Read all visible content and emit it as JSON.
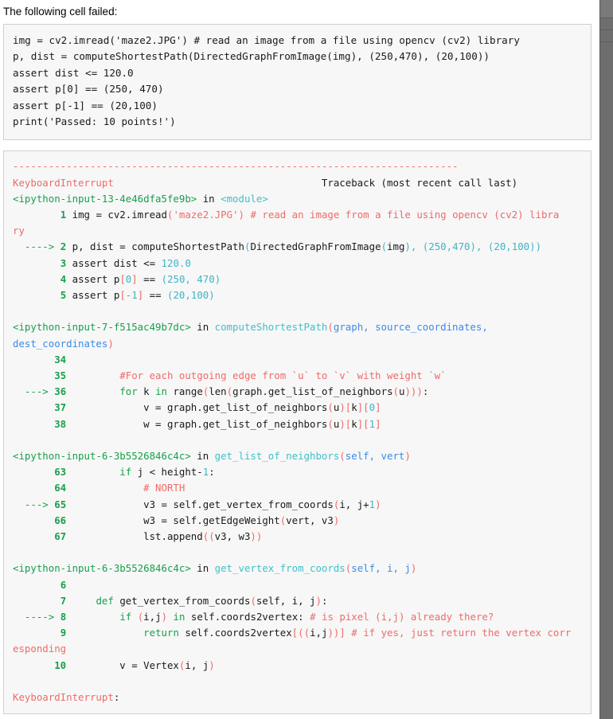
{
  "page": {
    "lead_text": "The following cell failed:",
    "background": "#ffffff",
    "cell_background": "#f7f7f7",
    "cell_border": "#cfcfcf"
  },
  "colors": {
    "string": "#ef6b68",
    "comment": "#ef6b68",
    "number": "#40b4c4",
    "keyword": "#18a04a",
    "function": "#3fc0c9",
    "argument": "#3b8ae8",
    "punctuation": "#ef6b68",
    "error": "#ef6b68",
    "line_number": "#18a04a",
    "scrollbar": "#6e6e6e"
  },
  "input_cell": {
    "lines": [
      [
        {
          "t": "img = cv2.imread(",
          "c": "plain"
        },
        {
          "t": "'maze2.JPG'",
          "c": "plain"
        },
        {
          "t": ") # read an image from a file using opencv (cv2) library",
          "c": "plain"
        }
      ],
      [
        {
          "t": "p, dist = computeShortestPath(DirectedGraphFromImage(img), (250,470), (20,100))",
          "c": "plain"
        }
      ],
      [
        {
          "t": "assert dist <= 120.0",
          "c": "plain"
        }
      ],
      [
        {
          "t": "assert p[0] == (250, 470)",
          "c": "plain"
        }
      ],
      [
        {
          "t": "assert p[-1] == (20,100)",
          "c": "plain"
        }
      ],
      [
        {
          "t": "print('Passed: 10 points!')",
          "c": "plain"
        }
      ]
    ]
  },
  "traceback": {
    "separator": "---------------------------------------------------------------------------",
    "exception_name": "KeyboardInterrupt",
    "exception_header_right": "Traceback (most recent call last)",
    "exception_footer": "KeyboardInterrupt:",
    "frames": [
      {
        "location": "<ipython-input-13-4e46dfa5fe9b>",
        "in_word": "in",
        "scope": "<module>",
        "scope_args": "",
        "lines": [
          {
            "arrow": "",
            "number": "1",
            "segments": [
              {
                "t": "img = cv2.imread",
                "c": "plain"
              },
              {
                "t": "(",
                "c": "punc"
              },
              {
                "t": "'maze2.JPG'",
                "c": "str"
              },
              {
                "t": ")",
                "c": "punc"
              },
              {
                "t": " # read an image from a file using opencv (cv2) libra",
                "c": "com"
              }
            ],
            "wrap": "ry",
            "wrap_class": "com"
          },
          {
            "arrow": "---->",
            "number": "2",
            "segments": [
              {
                "t": "p, dist = computeShortestPath",
                "c": "plain"
              },
              {
                "t": "(",
                "c": "num"
              },
              {
                "t": "DirectedGraphFromImage",
                "c": "plain"
              },
              {
                "t": "(",
                "c": "num"
              },
              {
                "t": "img",
                "c": "plain"
              },
              {
                "t": "), (",
                "c": "num"
              },
              {
                "t": "250",
                "c": "num"
              },
              {
                "t": ",",
                "c": "num"
              },
              {
                "t": "470",
                "c": "num"
              },
              {
                "t": "), (",
                "c": "num"
              },
              {
                "t": "20",
                "c": "num"
              },
              {
                "t": ",",
                "c": "num"
              },
              {
                "t": "100",
                "c": "num"
              },
              {
                "t": "))",
                "c": "num"
              }
            ],
            "wrap": "",
            "wrap_class": ""
          },
          {
            "arrow": "",
            "number": "3",
            "segments": [
              {
                "t": "assert dist <= ",
                "c": "plain"
              },
              {
                "t": "120.0",
                "c": "num"
              }
            ],
            "wrap": "",
            "wrap_class": ""
          },
          {
            "arrow": "",
            "number": "4",
            "segments": [
              {
                "t": "assert p",
                "c": "plain"
              },
              {
                "t": "[",
                "c": "punc"
              },
              {
                "t": "0",
                "c": "num"
              },
              {
                "t": "]",
                "c": "punc"
              },
              {
                "t": " == ",
                "c": "plain"
              },
              {
                "t": "(250, 470)",
                "c": "num"
              }
            ],
            "wrap": "",
            "wrap_class": ""
          },
          {
            "arrow": "",
            "number": "5",
            "segments": [
              {
                "t": "assert p",
                "c": "plain"
              },
              {
                "t": "[",
                "c": "punc"
              },
              {
                "t": "-1",
                "c": "num"
              },
              {
                "t": "]",
                "c": "punc"
              },
              {
                "t": " == ",
                "c": "plain"
              },
              {
                "t": "(20,100)",
                "c": "num"
              }
            ],
            "wrap": "",
            "wrap_class": ""
          }
        ]
      },
      {
        "location": "<ipython-input-7-f515ac49b7dc>",
        "in_word": "in",
        "scope": "computeShortestPath",
        "scope_args": "graph, source_coordinates, dest_coordinates",
        "scope_wrap": "dinates)",
        "scope_head": "computeShortestPath",
        "lines": [
          {
            "arrow": "",
            "number": "34",
            "segments": [],
            "wrap": "",
            "wrap_class": ""
          },
          {
            "arrow": "",
            "number": "35",
            "segments": [
              {
                "t": "        #For each outgoing edge from `u` to `v` with weight `w`",
                "c": "com"
              }
            ],
            "wrap": "",
            "wrap_class": ""
          },
          {
            "arrow": "--->",
            "number": "36",
            "segments": [
              {
                "t": "        ",
                "c": "plain"
              },
              {
                "t": "for",
                "c": "kw"
              },
              {
                "t": " k ",
                "c": "plain"
              },
              {
                "t": "in",
                "c": "kw"
              },
              {
                "t": " range",
                "c": "plain"
              },
              {
                "t": "(",
                "c": "punc"
              },
              {
                "t": "len",
                "c": "plain"
              },
              {
                "t": "(",
                "c": "punc"
              },
              {
                "t": "graph.get_list_of_neighbors",
                "c": "plain"
              },
              {
                "t": "(",
                "c": "punc"
              },
              {
                "t": "u",
                "c": "plain"
              },
              {
                "t": ")))",
                "c": "punc"
              },
              {
                "t": ":",
                "c": "plain"
              }
            ],
            "wrap": "",
            "wrap_class": ""
          },
          {
            "arrow": "",
            "number": "37",
            "segments": [
              {
                "t": "            v = graph.get_list_of_neighbors",
                "c": "plain"
              },
              {
                "t": "(",
                "c": "punc"
              },
              {
                "t": "u",
                "c": "plain"
              },
              {
                "t": ")[",
                "c": "punc"
              },
              {
                "t": "k",
                "c": "plain"
              },
              {
                "t": "][",
                "c": "punc"
              },
              {
                "t": "0",
                "c": "num"
              },
              {
                "t": "]",
                "c": "punc"
              }
            ],
            "wrap": "",
            "wrap_class": ""
          },
          {
            "arrow": "",
            "number": "38",
            "segments": [
              {
                "t": "            w = graph.get_list_of_neighbors",
                "c": "plain"
              },
              {
                "t": "(",
                "c": "punc"
              },
              {
                "t": "u",
                "c": "plain"
              },
              {
                "t": ")[",
                "c": "punc"
              },
              {
                "t": "k",
                "c": "plain"
              },
              {
                "t": "][",
                "c": "punc"
              },
              {
                "t": "1",
                "c": "num"
              },
              {
                "t": "]",
                "c": "punc"
              }
            ],
            "wrap": "",
            "wrap_class": ""
          }
        ]
      },
      {
        "location": "<ipython-input-6-3b5526846c4c>",
        "in_word": "in",
        "scope": "get_list_of_neighbors",
        "scope_args": "self, vert",
        "lines": [
          {
            "arrow": "",
            "number": "63",
            "segments": [
              {
                "t": "        ",
                "c": "plain"
              },
              {
                "t": "if",
                "c": "kw"
              },
              {
                "t": " j < height-",
                "c": "plain"
              },
              {
                "t": "1",
                "c": "num"
              },
              {
                "t": ":",
                "c": "plain"
              }
            ],
            "wrap": "",
            "wrap_class": ""
          },
          {
            "arrow": "",
            "number": "64",
            "segments": [
              {
                "t": "            # NORTH",
                "c": "com"
              }
            ],
            "wrap": "",
            "wrap_class": ""
          },
          {
            "arrow": "--->",
            "number": "65",
            "segments": [
              {
                "t": "            v3 = self.get_vertex_from_coords",
                "c": "plain"
              },
              {
                "t": "(",
                "c": "punc"
              },
              {
                "t": "i, j+",
                "c": "plain"
              },
              {
                "t": "1",
                "c": "num"
              },
              {
                "t": ")",
                "c": "punc"
              }
            ],
            "wrap": "",
            "wrap_class": ""
          },
          {
            "arrow": "",
            "number": "66",
            "segments": [
              {
                "t": "            w3 = self.getEdgeWeight",
                "c": "plain"
              },
              {
                "t": "(",
                "c": "punc"
              },
              {
                "t": "vert, v3",
                "c": "plain"
              },
              {
                "t": ")",
                "c": "punc"
              }
            ],
            "wrap": "",
            "wrap_class": ""
          },
          {
            "arrow": "",
            "number": "67",
            "segments": [
              {
                "t": "            lst.append",
                "c": "plain"
              },
              {
                "t": "((",
                "c": "punc"
              },
              {
                "t": "v3, w3",
                "c": "plain"
              },
              {
                "t": "))",
                "c": "punc"
              }
            ],
            "wrap": "",
            "wrap_class": ""
          }
        ]
      },
      {
        "location": "<ipython-input-6-3b5526846c4c>",
        "in_word": "in",
        "scope": "get_vertex_from_coords",
        "scope_args": "self, i, j",
        "lines": [
          {
            "arrow": "",
            "number": "6",
            "segments": [],
            "wrap": "",
            "wrap_class": ""
          },
          {
            "arrow": "",
            "number": "7",
            "segments": [
              {
                "t": "    ",
                "c": "plain"
              },
              {
                "t": "def",
                "c": "kw"
              },
              {
                "t": " get_vertex_from_coords",
                "c": "plain"
              },
              {
                "t": "(",
                "c": "punc"
              },
              {
                "t": "self, i, j",
                "c": "plain"
              },
              {
                "t": ")",
                "c": "punc"
              },
              {
                "t": ":",
                "c": "plain"
              }
            ],
            "wrap": "",
            "wrap_class": ""
          },
          {
            "arrow": "---->",
            "number": "8",
            "segments": [
              {
                "t": "        ",
                "c": "plain"
              },
              {
                "t": "if",
                "c": "kw"
              },
              {
                "t": " ",
                "c": "plain"
              },
              {
                "t": "(",
                "c": "punc"
              },
              {
                "t": "i,j",
                "c": "plain"
              },
              {
                "t": ")",
                "c": "punc"
              },
              {
                "t": " ",
                "c": "plain"
              },
              {
                "t": "in",
                "c": "kw"
              },
              {
                "t": " self.coords2vertex:",
                "c": "plain"
              },
              {
                "t": " # is pixel (i,j) already there?",
                "c": "com"
              }
            ],
            "wrap": "",
            "wrap_class": ""
          },
          {
            "arrow": "",
            "number": "9",
            "segments": [
              {
                "t": "            ",
                "c": "plain"
              },
              {
                "t": "return",
                "c": "kw"
              },
              {
                "t": " self.coords2vertex",
                "c": "plain"
              },
              {
                "t": "[((",
                "c": "punc"
              },
              {
                "t": "i,j",
                "c": "plain"
              },
              {
                "t": "))]",
                "c": "punc"
              },
              {
                "t": " # if yes, just return the vertex corr",
                "c": "com"
              }
            ],
            "wrap": "esponding",
            "wrap_class": "com"
          },
          {
            "arrow": "",
            "number": "10",
            "segments": [
              {
                "t": "        v = Vertex",
                "c": "plain"
              },
              {
                "t": "(",
                "c": "punc"
              },
              {
                "t": "i, j",
                "c": "plain"
              },
              {
                "t": ")",
                "c": "punc"
              }
            ],
            "wrap": "",
            "wrap_class": ""
          }
        ]
      }
    ]
  }
}
